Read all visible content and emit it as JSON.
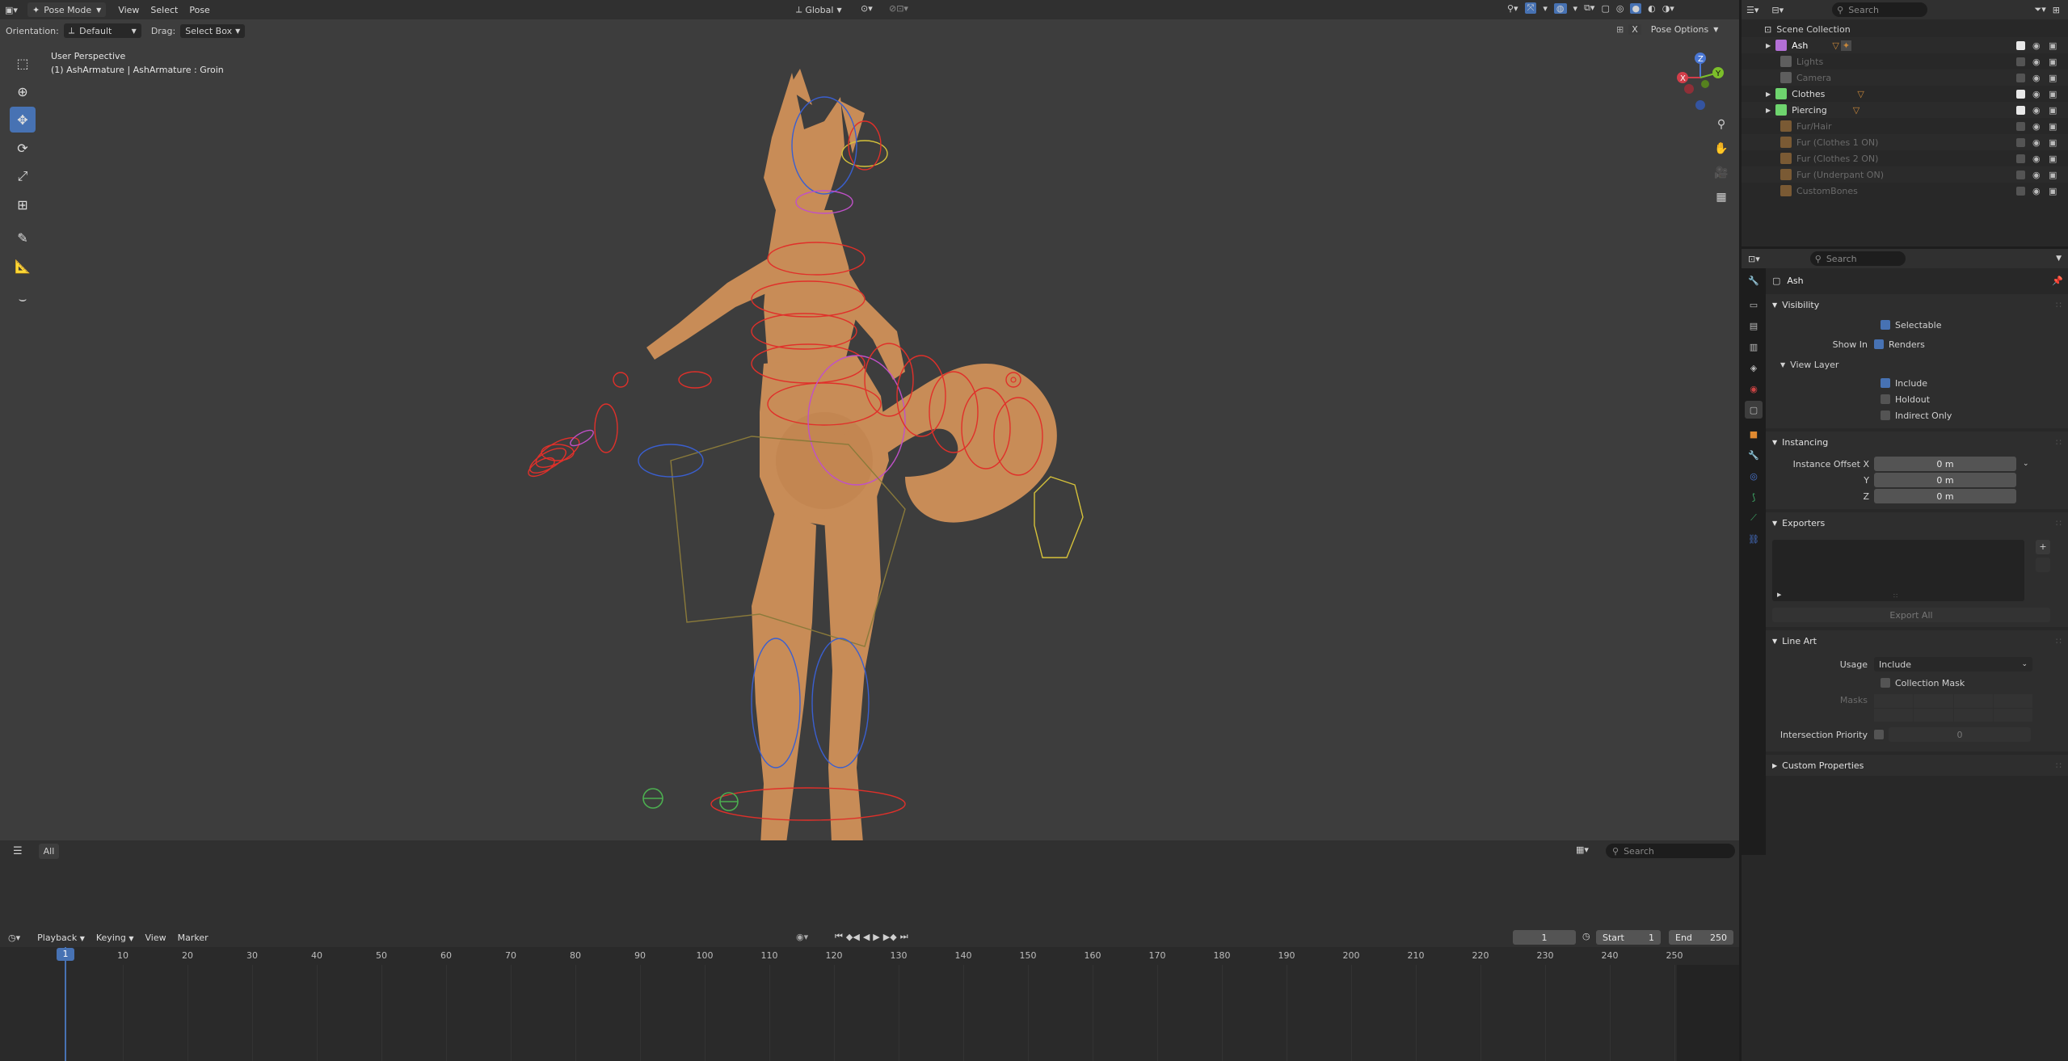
{
  "viewport": {
    "mode": "Pose Mode",
    "menus": [
      "View",
      "Select",
      "Pose"
    ],
    "transform_orientation": "Global",
    "orientation_label": "Orientation:",
    "orientation_value": "Default",
    "drag_label": "Drag:",
    "drag_value": "Select Box",
    "pose_options": "Pose Options",
    "overlay_line1": "User Perspective",
    "overlay_line2": "(1) AshArmature | AshArmature : Groin",
    "bottom_tab": "All",
    "search_placeholder": "Search",
    "gizmo_labels": [
      "X",
      "Y",
      "Z"
    ]
  },
  "outliner": {
    "search_placeholder": "Search",
    "root": "Scene Collection",
    "items": [
      {
        "name": "Ash",
        "enabled": true,
        "color": "#b36fd6"
      },
      {
        "name": "Lights",
        "enabled": false,
        "color": "#7a7a7a"
      },
      {
        "name": "Camera",
        "enabled": false,
        "color": "#7a7a7a"
      },
      {
        "name": "Clothes",
        "enabled": true,
        "color": "#6ed46e"
      },
      {
        "name": "Piercing",
        "enabled": true,
        "color": "#6ed46e"
      },
      {
        "name": "Fur/Hair",
        "enabled": false,
        "color": "#c8873a"
      },
      {
        "name": "Fur (Clothes 1 ON)",
        "enabled": false,
        "color": "#c8873a"
      },
      {
        "name": "Fur (Clothes 2 ON)",
        "enabled": false,
        "color": "#c8873a"
      },
      {
        "name": "Fur (Underpant ON)",
        "enabled": false,
        "color": "#c8873a"
      },
      {
        "name": "CustomBones",
        "enabled": false,
        "color": "#c8873a"
      }
    ]
  },
  "properties": {
    "search_placeholder": "Search",
    "object_name": "Ash",
    "visibility": {
      "title": "Visibility",
      "selectable": "Selectable",
      "show_in_label": "Show In",
      "renders": "Renders",
      "view_layer": "View Layer",
      "include": "Include",
      "holdout": "Holdout",
      "indirect_only": "Indirect Only"
    },
    "instancing": {
      "title": "Instancing",
      "offset_x_label": "Instance Offset X",
      "y_label": "Y",
      "z_label": "Z",
      "x_value": "0 m",
      "y_value": "0 m",
      "z_value": "0 m"
    },
    "exporters": {
      "title": "Exporters",
      "export_all": "Export All"
    },
    "line_art": {
      "title": "Line Art",
      "usage_label": "Usage",
      "usage_value": "Include",
      "collection_mask": "Collection Mask",
      "masks_label": "Masks",
      "intersection_label": "Intersection Priority",
      "intersection_value": "0"
    },
    "custom_properties": "Custom Properties"
  },
  "timeline": {
    "menus": [
      "Playback",
      "Keying",
      "View",
      "Marker"
    ],
    "current_frame": "1",
    "start_label": "Start",
    "start_value": "1",
    "end_label": "End",
    "end_value": "250",
    "ticks": [
      "1",
      "10",
      "20",
      "30",
      "40",
      "50",
      "60",
      "70",
      "80",
      "90",
      "100",
      "110",
      "120",
      "130",
      "140",
      "150",
      "160",
      "170",
      "180",
      "190",
      "200",
      "210",
      "220",
      "230",
      "240",
      "250"
    ]
  },
  "colors": {
    "accent": "#4772b3",
    "skin": "#c88c57",
    "bone_red": "#e0302a",
    "bone_blue": "#3a5fd0",
    "bone_magenta": "#c050c8",
    "bone_yellow": "#d6c23a"
  }
}
